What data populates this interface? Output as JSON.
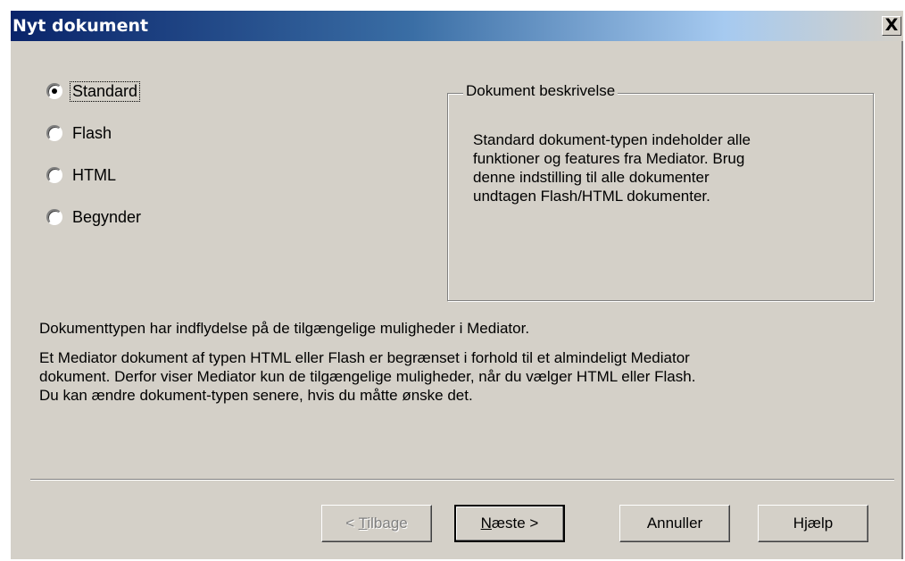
{
  "window": {
    "title": "Nyt dokument",
    "close_glyph": "X"
  },
  "radio_options": [
    {
      "label": "Standard",
      "checked": true
    },
    {
      "label": "Flash",
      "checked": false
    },
    {
      "label": "HTML",
      "checked": false
    },
    {
      "label": "Begynder",
      "checked": false
    }
  ],
  "description_group": {
    "legend": "Dokument beskrivelse",
    "text_lines": [
      "Standard dokument-typen indeholder alle",
      "funktioner og features fra Mediator. Brug",
      "denne indstilling til alle dokumenter",
      "undtagen Flash/HTML dokumenter."
    ]
  },
  "info": {
    "line1": "Dokumenttypen har indflydelse på de tilgængelige muligheder i Mediator.",
    "paragraph_lines": [
      "Et Mediator dokument af typen HTML eller Flash er begrænset i forhold til et almindeligt Mediator",
      "dokument. Derfor viser Mediator kun de tilgængelige muligheder, når du vælger HTML eller Flash.",
      "Du kan ændre dokument-typen senere, hvis du måtte ønske det."
    ]
  },
  "buttons": {
    "back": {
      "prefix": "< ",
      "mnemonic": "T",
      "rest": "ilbage",
      "enabled": false
    },
    "next": {
      "prefix": "",
      "mnemonic": "N",
      "rest": "æste >",
      "enabled": true
    },
    "cancel": {
      "label": "Annuller",
      "enabled": true
    },
    "help": {
      "label": "Hjælp",
      "enabled": true
    }
  }
}
